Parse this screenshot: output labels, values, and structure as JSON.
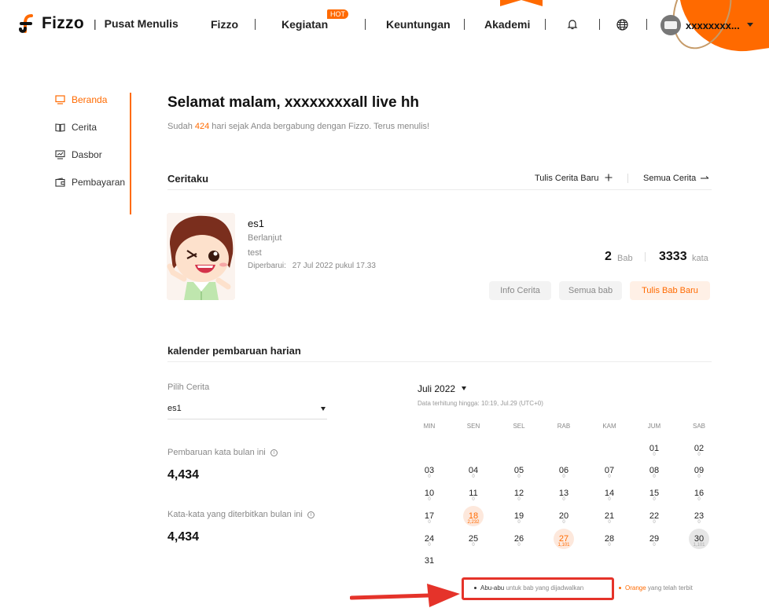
{
  "header": {
    "logo_text": "Fizzo",
    "separator": "|",
    "subtitle": "Pusat Menulis",
    "nav": [
      "Fizzo",
      "Kegiatan",
      "Keuntungan",
      "Akademi"
    ],
    "hot_badge": "HOT",
    "username": "xxxxxxxx..."
  },
  "sidebar": {
    "items": [
      {
        "label": "Beranda",
        "icon": "monitor-icon",
        "active": true
      },
      {
        "label": "Cerita",
        "icon": "book-icon"
      },
      {
        "label": "Dasbor",
        "icon": "chart-icon"
      },
      {
        "label": "Pembayaran",
        "icon": "wallet-icon"
      }
    ]
  },
  "greeting": {
    "title": "Selamat malam, xxxxxxxxall live hh",
    "sub_prefix": "Sudah",
    "days": "424",
    "sub_suffix": "hari sejak Anda bergabung dengan Fizzo. Terus menulis!"
  },
  "ceritaku": {
    "title": "Ceritaku",
    "new_story": "Tulis Cerita Baru",
    "all_stories": "Semua Cerita",
    "story": {
      "title": "es1",
      "status": "Berlanjut",
      "tag": "test",
      "updated_label": "Diperbarui:",
      "updated_value": "27 Jul 2022 pukul 17.33",
      "chapters": "2",
      "chapters_label": "Bab",
      "words": "3333",
      "words_label": "kata"
    },
    "buttons": {
      "info": "Info Cerita",
      "all_chapters": "Semua bab",
      "new_chapter": "Tulis Bab Baru"
    }
  },
  "calendar_section": {
    "title": "kalender pembaruan harian",
    "pick_label": "Pilih Cerita",
    "pick_value": "es1",
    "month_words_label": "Pembaruan kata bulan ini",
    "month_words": "4,434",
    "published_label": "Kata-kata yang diterbitkan bulan ini",
    "published": "4,434",
    "month": "Juli 2022",
    "calc_note": "Data terhitung hingga: 10:19, Jul.29  (UTC+0)",
    "weekdays": [
      "MIN",
      "SEN",
      "SEL",
      "RAB",
      "KAM",
      "JUM",
      "SAB"
    ],
    "days": [
      {
        "d": "01",
        "c": "0"
      },
      {
        "d": "02",
        "c": "0"
      },
      {
        "d": "03",
        "c": "0"
      },
      {
        "d": "04",
        "c": "0"
      },
      {
        "d": "05",
        "c": "0"
      },
      {
        "d": "06",
        "c": "0"
      },
      {
        "d": "07",
        "c": "0"
      },
      {
        "d": "08",
        "c": "0"
      },
      {
        "d": "09",
        "c": "0"
      },
      {
        "d": "10",
        "c": "0"
      },
      {
        "d": "11",
        "c": "0"
      },
      {
        "d": "12",
        "c": "0"
      },
      {
        "d": "13",
        "c": "0"
      },
      {
        "d": "14",
        "c": "0"
      },
      {
        "d": "15",
        "c": "0"
      },
      {
        "d": "16",
        "c": "0"
      },
      {
        "d": "17",
        "c": "0"
      },
      {
        "d": "18",
        "c": "2,232",
        "hl": "orange"
      },
      {
        "d": "19",
        "c": "0"
      },
      {
        "d": "20",
        "c": "0"
      },
      {
        "d": "21",
        "c": "0"
      },
      {
        "d": "22",
        "c": "0"
      },
      {
        "d": "23",
        "c": "0"
      },
      {
        "d": "24",
        "c": "0"
      },
      {
        "d": "25",
        "c": "0"
      },
      {
        "d": "26",
        "c": "0"
      },
      {
        "d": "27",
        "c": "1,101",
        "hl": "orange"
      },
      {
        "d": "28",
        "c": "0"
      },
      {
        "d": "29",
        "c": "0"
      },
      {
        "d": "30",
        "c": "1,101",
        "hl": "gray"
      },
      {
        "d": "31",
        "c": ""
      }
    ],
    "legend_gray_strong": "Abu-abu",
    "legend_gray_text": "untuk bab yang dijadwalkan",
    "legend_orange_strong": "Orange",
    "legend_orange_text": "yang telah terbit"
  },
  "colors": {
    "accent": "#ff6a00",
    "annotation": "#e5332a"
  }
}
